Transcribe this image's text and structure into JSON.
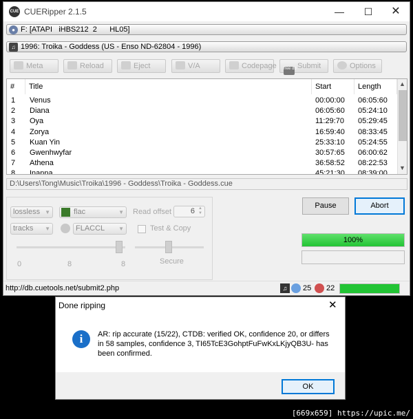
{
  "window": {
    "title": "CUERipper 2.1.5",
    "app_icon": "CUE"
  },
  "drive_bar": {
    "label": "F: [ATAPI   iHBS212  2      HL05]"
  },
  "release_bar": {
    "label": "1996: Troika - Goddess (US - Enso ND-62804 - 1996)"
  },
  "toolbar": [
    "Meta",
    "Reload",
    "Eject",
    "V/A",
    "Codepage",
    "Submit",
    "Options"
  ],
  "toolbar_submit_badge": "free db",
  "tracklist": {
    "columns": [
      "#",
      "Title",
      "Start",
      "Length"
    ],
    "rows": [
      {
        "n": "1",
        "title": "Venus",
        "start": "00:00:00",
        "length": "06:05:60"
      },
      {
        "n": "2",
        "title": "Diana",
        "start": "06:05:60",
        "length": "05:24:10"
      },
      {
        "n": "3",
        "title": "Oya",
        "start": "11:29:70",
        "length": "05:29:45"
      },
      {
        "n": "4",
        "title": "Zorya",
        "start": "16:59:40",
        "length": "08:33:45"
      },
      {
        "n": "5",
        "title": "Kuan Yin",
        "start": "25:33:10",
        "length": "05:24:55"
      },
      {
        "n": "6",
        "title": "Gwenhwyfar",
        "start": "30:57:65",
        "length": "06:00:62"
      },
      {
        "n": "7",
        "title": "Athena",
        "start": "36:58:52",
        "length": "08:22:53"
      },
      {
        "n": "8",
        "title": "Inanna",
        "start": "45:21:30",
        "length": "08:39:00"
      }
    ]
  },
  "output_path": "D:\\Users\\Tong\\Music\\Troika\\1996 - Goddess\\Troika - Goddess.cue",
  "settings": {
    "format_mode": "lossless",
    "codec": "flac",
    "track_mode": "tracks",
    "encoder": "FLACCL",
    "read_offset_label": "Read offset",
    "read_offset_value": "6",
    "test_copy_label": "Test & Copy",
    "slider_ticks": [
      "0",
      "8",
      "8"
    ],
    "secure_label": "Secure"
  },
  "buttons": {
    "pause": "Pause",
    "abort": "Abort"
  },
  "progress": {
    "label": "100%",
    "value": 1.0,
    "color": "#2ecc40"
  },
  "status_bar": {
    "url": "http://db.cuetools.net/submit2.php",
    "ar_count": "25",
    "ctdb_count": "22",
    "progress_value": 1.0
  },
  "dialog": {
    "title": "Done ripping",
    "icon": "info-icon",
    "message": "AR: rip accurate (15/22), CTDB: verified OK, confidence 20, or differs in 58 samples, confidence 3, TI65TcE3GohptFuFwKxLKjyQB3U- has been confirmed.",
    "ok_label": "OK"
  },
  "footer": "[669x659] https://upic.me/"
}
